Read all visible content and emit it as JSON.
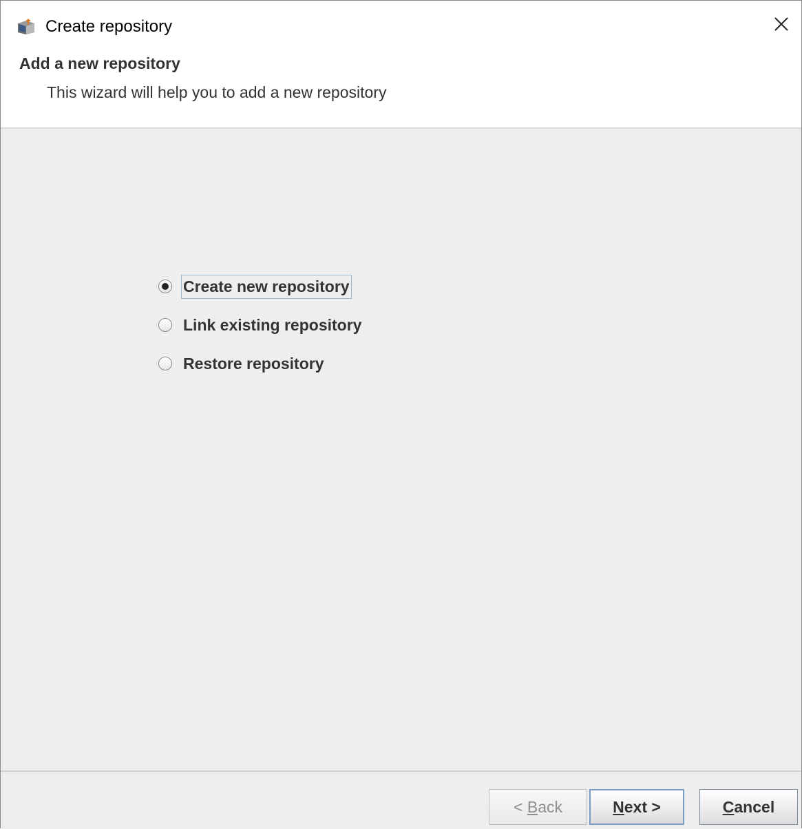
{
  "window": {
    "title": "Create repository",
    "app_icon": "repository-app-icon",
    "close_icon": "close-icon"
  },
  "header": {
    "title": "Add a new repository",
    "subtitle": "This wizard will help you to add a new repository"
  },
  "options": {
    "items": [
      {
        "label": "Create new repository",
        "selected": true
      },
      {
        "label": "Link existing repository",
        "selected": false
      },
      {
        "label": "Restore repository",
        "selected": false
      }
    ]
  },
  "footer": {
    "back": {
      "prefix": "< ",
      "mnemonic": "B",
      "rest": "ack",
      "enabled": false
    },
    "next": {
      "mnemonic": "N",
      "rest": "ext >",
      "enabled": true
    },
    "cancel": {
      "mnemonic": "C",
      "rest": "ancel",
      "enabled": true
    }
  },
  "colors": {
    "content_background": "#eeeeee",
    "header_background": "#ffffff",
    "focus_border": "#9fb4cc"
  }
}
